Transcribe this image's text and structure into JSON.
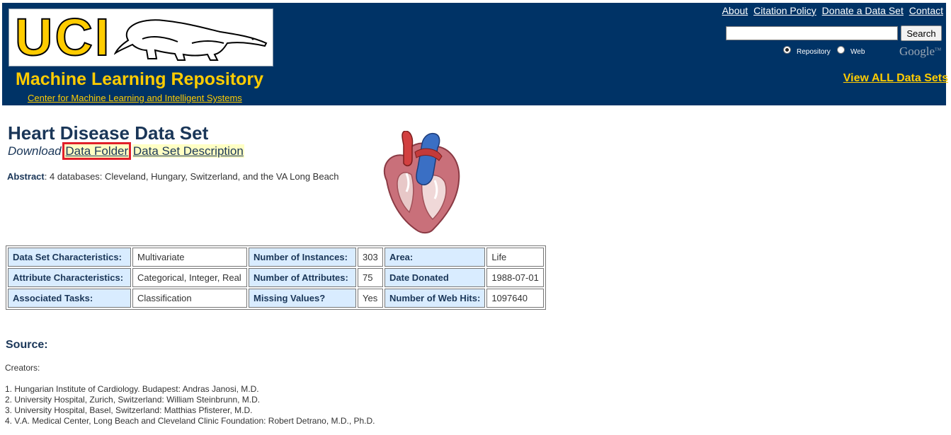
{
  "header": {
    "logo_text": "UCI",
    "site_title": "Machine Learning Repository",
    "site_subtitle": "Center for Machine Learning and Intelligent Systems",
    "top_links": [
      "About",
      "Citation Policy",
      "Donate a Data Set",
      "Contact"
    ],
    "search": {
      "value": "",
      "button_label": "Search"
    },
    "radio_options": [
      {
        "label": "Repository",
        "checked": true
      },
      {
        "label": "Web",
        "checked": false
      }
    ],
    "google_logo_text": "Google",
    "view_all_label": "View ALL Data Sets",
    "colors": {
      "header_bg": "#003366",
      "accent": "#ffcc00"
    }
  },
  "main": {
    "title": "Heart Disease Data Set",
    "download_label": "Download",
    "download_links": [
      "Data Folder",
      "Data Set Description"
    ],
    "abstract_label": "Abstract",
    "abstract_text": ": 4 databases: Cleveland, Hungary, Switzerland, and the VA Long Beach",
    "image_icon": "heart-anatomy-image"
  },
  "info_table": [
    [
      {
        "text": "Data Set Characteristics:",
        "header": true
      },
      {
        "text": "Multivariate"
      },
      {
        "text": "Number of Instances:",
        "header": true
      },
      {
        "text": "303"
      },
      {
        "text": "Area:",
        "header": true
      },
      {
        "text": "Life"
      }
    ],
    [
      {
        "text": "Attribute Characteristics:",
        "header": true
      },
      {
        "text": "Categorical, Integer, Real"
      },
      {
        "text": "Number of Attributes:",
        "header": true
      },
      {
        "text": "75"
      },
      {
        "text": "Date Donated",
        "header": true
      },
      {
        "text": "1988-07-01"
      }
    ],
    [
      {
        "text": "Associated Tasks:",
        "header": true
      },
      {
        "text": "Classification"
      },
      {
        "text": "Missing Values?",
        "header": true
      },
      {
        "text": "Yes"
      },
      {
        "text": "Number of Web Hits:",
        "header": true
      },
      {
        "text": "1097640"
      }
    ]
  ],
  "source": {
    "heading": "Source:",
    "creators_label": "Creators:",
    "creators": [
      "1. Hungarian Institute of Cardiology. Budapest: Andras Janosi, M.D.",
      "2. University Hospital, Zurich, Switzerland: William Steinbrunn, M.D.",
      "3. University Hospital, Basel, Switzerland: Matthias Pfisterer, M.D.",
      "4. V.A. Medical Center, Long Beach and Cleveland Clinic Foundation: Robert Detrano, M.D., Ph.D."
    ]
  }
}
